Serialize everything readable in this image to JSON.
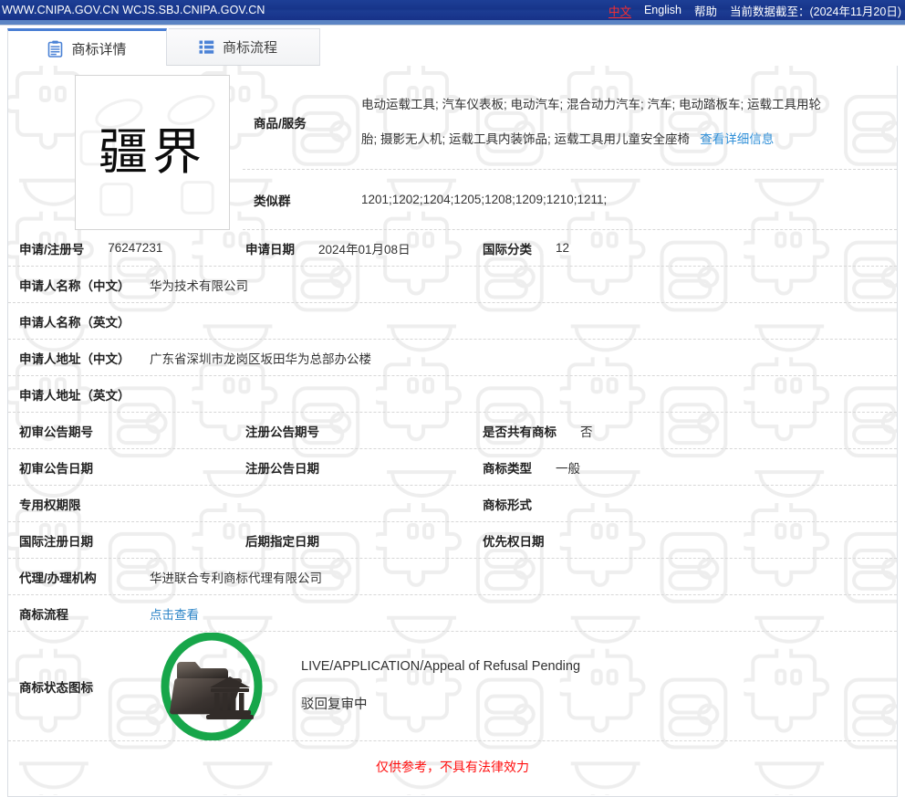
{
  "topbar": {
    "domains": "WWW.CNIPA.GOV.CN WCJS.SBJ.CNIPA.GOV.CN",
    "lang_zh": "中文",
    "lang_en": "English",
    "help": "帮助",
    "data_cutoff": "当前数据截至：(2024年11月20日)",
    "bg_color": "#1a3a8f",
    "zh_color": "#ff2d2d"
  },
  "tabs": [
    {
      "label": "商标详情",
      "icon": "clipboard-icon",
      "active": true
    },
    {
      "label": "商标流程",
      "icon": "list-grid-icon",
      "active": false
    }
  ],
  "mark": {
    "image_text": "疆界",
    "alt": "trademark-image"
  },
  "details": {
    "goods_label": "商品/服务",
    "goods_line1": "电动运载工具; 汽车仪表板; 电动汽车; 混合动力汽车; 汽车; 电动踏板车; 运载工具用轮",
    "goods_line2": "胎; 摄影无人机; 运载工具内装饰品; 运载工具用儿童安全座椅",
    "goods_more_link": "查看详细信息",
    "similar_group_label": "类似群",
    "similar_group_value": "1201;1202;1204;1205;1208;1209;1210;1211;",
    "app_no_label": "申请/注册号",
    "app_no_value": "76247231",
    "app_date_label": "申请日期",
    "app_date_value": "2024年01月08日",
    "intl_class_label": "国际分类",
    "intl_class_value": "12",
    "applicant_cn_label": "申请人名称（中文）",
    "applicant_cn_value": "华为技术有限公司",
    "applicant_en_label": "申请人名称（英文）",
    "applicant_en_value": "",
    "address_cn_label": "申请人地址（中文）",
    "address_cn_value": "广东省深圳市龙岗区坂田华为总部办公楼",
    "address_en_label": "申请人地址（英文）",
    "address_en_value": "",
    "agent_label": "代理/办理机构",
    "agent_value": "华进联合专利商标代理有限公司",
    "process_label": "商标流程",
    "process_link": "点击查看"
  },
  "grid_rows": [
    {
      "a_key": "初审公告期号",
      "a_val": "",
      "b_key": "注册公告期号",
      "b_val": "",
      "c_key": "是否共有商标",
      "c_val": "否"
    },
    {
      "a_key": "初审公告日期",
      "a_val": "",
      "b_key": "注册公告日期",
      "b_val": "",
      "c_key": "商标类型",
      "c_val": "一般"
    },
    {
      "a_key": "专用权期限",
      "a_val": "",
      "b_key": "",
      "b_val": "",
      "c_key": "商标形式",
      "c_val": ""
    },
    {
      "a_key": "国际注册日期",
      "a_val": "",
      "b_key": "后期指定日期",
      "b_val": "",
      "c_key": "优先权日期",
      "c_val": ""
    }
  ],
  "status": {
    "label": "商标状态图标",
    "icon": "folder-courthouse-icon",
    "ring_color": "#17a64a",
    "line1": "LIVE/APPLICATION/Appeal of Refusal Pending",
    "line2": "驳回复审中"
  },
  "disclaimer": {
    "text": "仅供参考，不具有法律效力",
    "color": "#ff0f0f"
  }
}
